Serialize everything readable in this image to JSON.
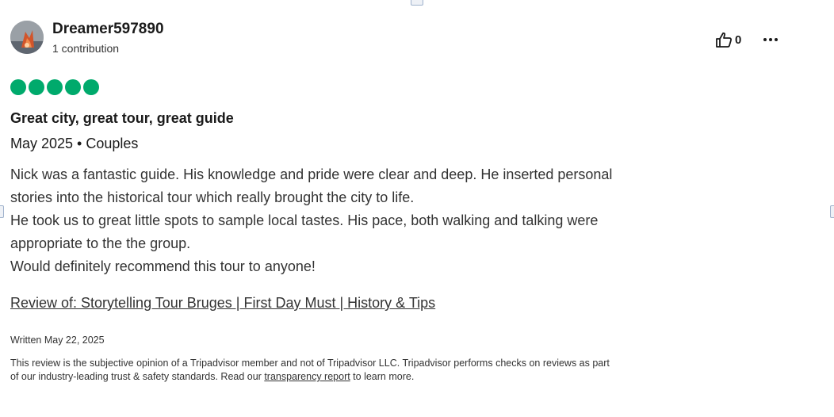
{
  "review": {
    "author": {
      "username": "Dreamer597890",
      "contributions": "1 contribution"
    },
    "votes": {
      "count": "0"
    },
    "rating": {
      "value": 5,
      "max": 5,
      "color": "#00aa6c"
    },
    "title": "Great city, great tour, great guide",
    "meta": "May 2025 • Couples",
    "body_lines": [
      "Nick was a fantastic guide. His knowledge and pride were clear and deep. He inserted personal",
      "stories into the historical tour which really brought the city to life.",
      "He took us to great little spots to sample local tastes. His pace, both walking and talking were",
      "appropriate to the the group.",
      "Would definitely recommend this tour to anyone!"
    ],
    "review_of_link": "Review of: Storytelling Tour Bruges | First Day Must | History & Tips",
    "written_date": "Written May 22, 2025",
    "disclaimer": {
      "line1": "This review is the subjective opinion of a Tripadvisor member and not of Tripadvisor LLC. Tripadvisor performs checks on reviews as part",
      "line2_prefix": "of our industry-leading trust & safety standards. Read our ",
      "link_text": "transparency report",
      "line2_suffix": " to learn more."
    }
  },
  "icons": {
    "helpful_vote": "thumbs-up-icon",
    "more_options": "more-options-icon"
  }
}
